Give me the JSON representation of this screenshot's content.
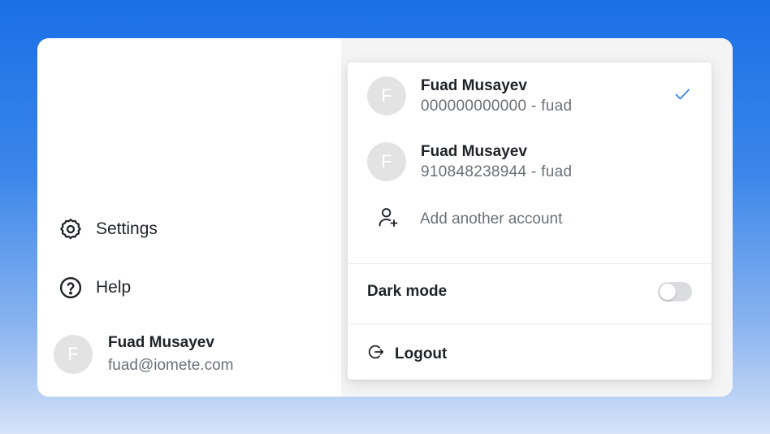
{
  "sidebar": {
    "settings_label": "Settings",
    "help_label": "Help",
    "user": {
      "initial": "F",
      "name": "Fuad Musayev",
      "email": "fuad@iomete.com"
    }
  },
  "account_menu": {
    "accounts": [
      {
        "initial": "F",
        "name": "Fuad Musayev",
        "subtitle": "000000000000 - fuad",
        "selected": true
      },
      {
        "initial": "F",
        "name": "Fuad Musayev",
        "subtitle": "910848238944 - fuad",
        "selected": false
      }
    ],
    "add_account_label": "Add another account",
    "dark_mode_label": "Dark mode",
    "dark_mode_enabled": false,
    "logout_label": "Logout"
  },
  "colors": {
    "background_top": "#1a6fe6",
    "background_bottom": "#d5e2f8",
    "accent_check": "#3b82f6",
    "avatar_bg": "#e3e3e3",
    "toggle_off": "#dadce0"
  },
  "icons": {
    "settings": "gear-icon",
    "help": "help-circle-icon",
    "add_account": "add-user-icon",
    "selected": "check-icon",
    "logout": "logout-icon"
  }
}
